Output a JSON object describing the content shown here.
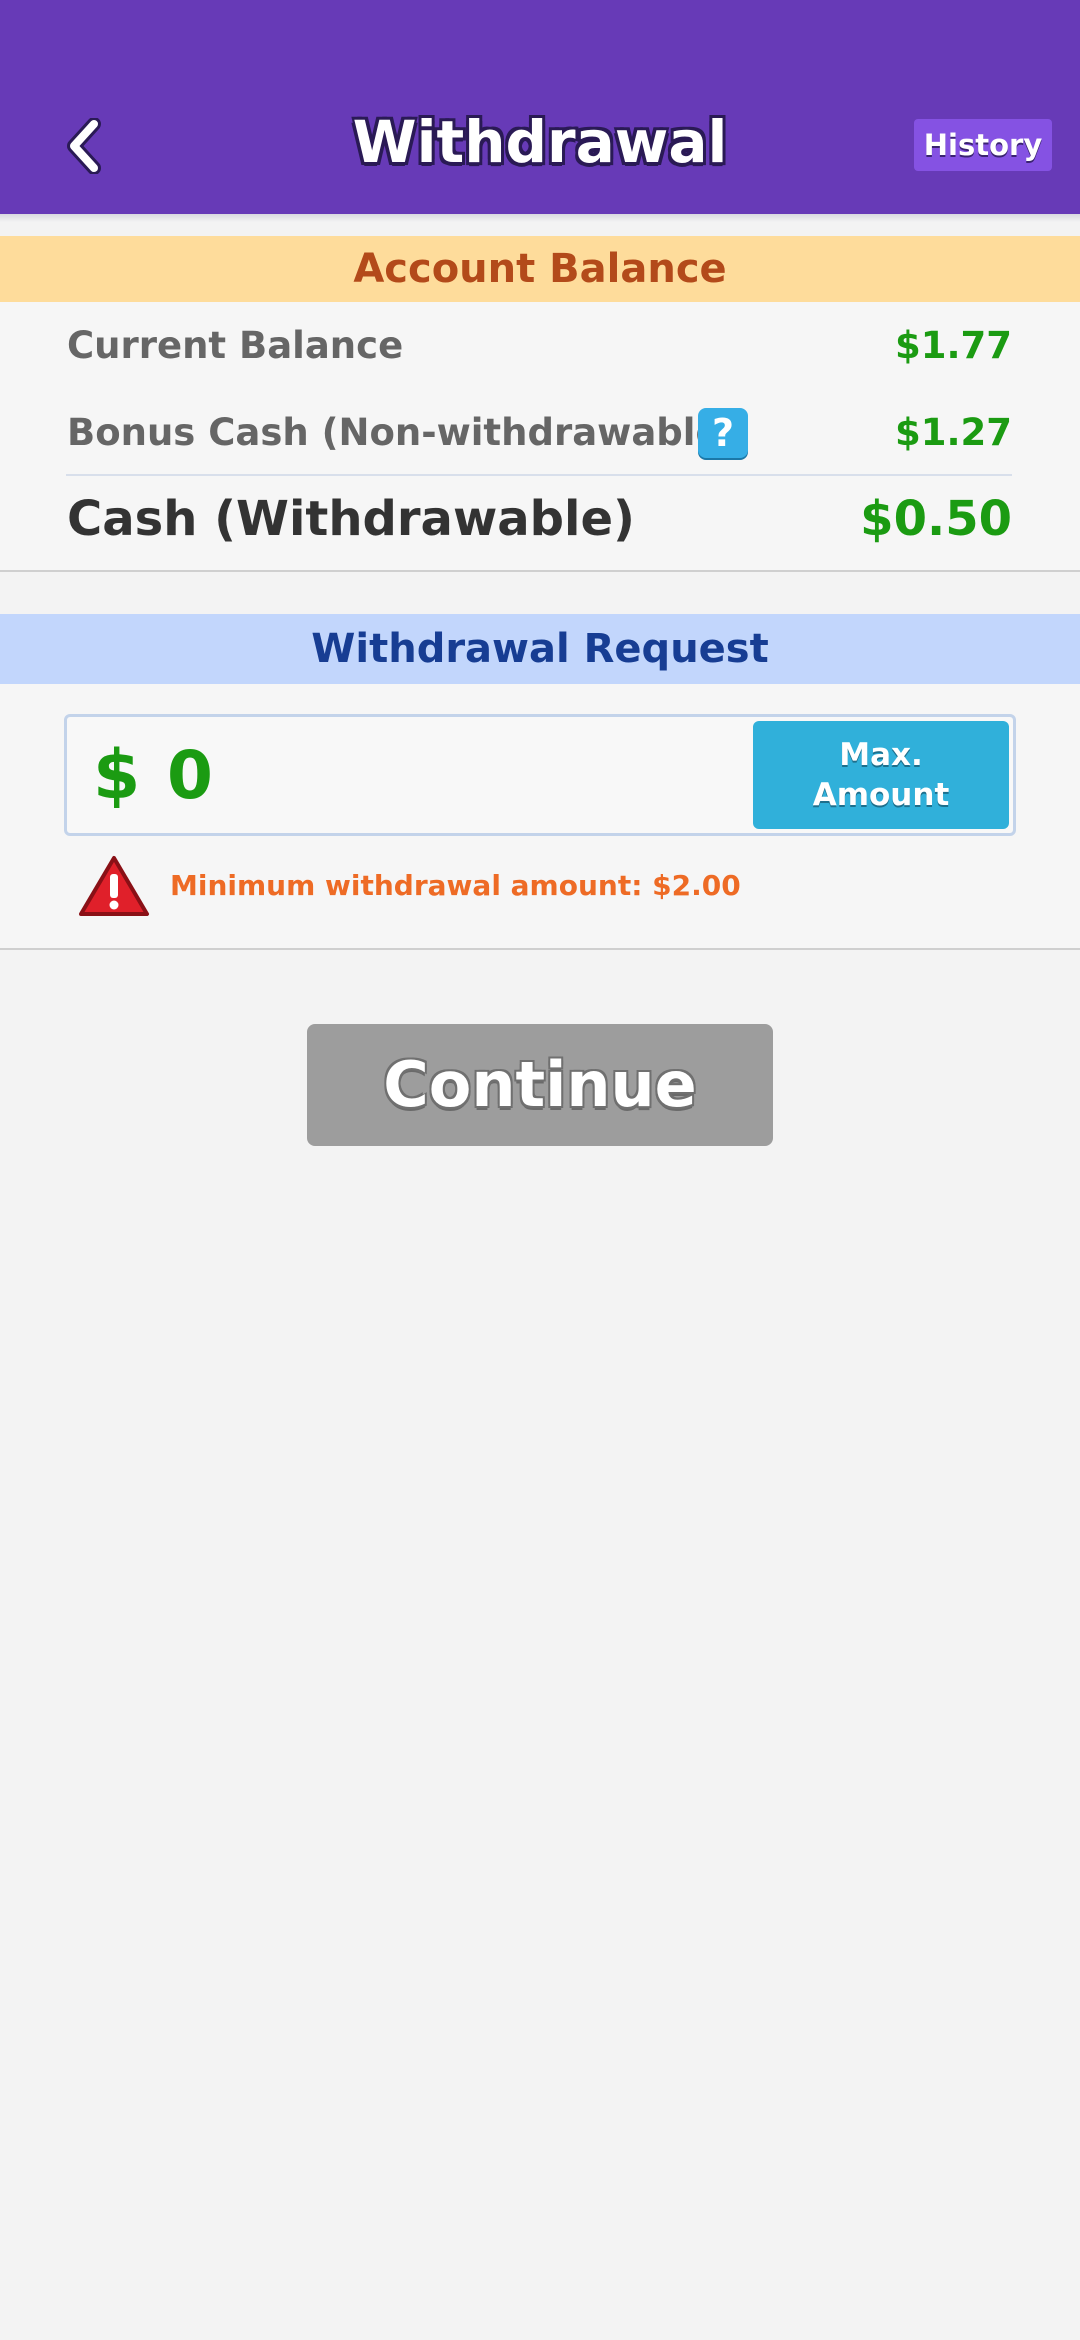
{
  "header": {
    "title": "Withdrawal",
    "back_icon": "chevron-left-icon",
    "history_label": "History",
    "color": "#673ab7"
  },
  "account_balance": {
    "heading": "Account Balance",
    "rows": [
      {
        "label": "Current Balance",
        "value": "$1.77"
      },
      {
        "label": "Bonus Cash (Non-withdrawable)",
        "value": "$1.27",
        "help_icon": "question-mark-icon",
        "help_text": "?"
      }
    ],
    "total": {
      "label": "Cash (Withdrawable)",
      "value": "$0.50"
    }
  },
  "withdrawal_request": {
    "heading": "Withdrawal Request",
    "currency_symbol": "$",
    "amount_value": "0",
    "max_button": {
      "line1": "Max.",
      "line2": "Amount"
    },
    "warning_icon": "warning-triangle-icon",
    "warning_text": "Minimum withdrawal amount: $2.00"
  },
  "continue_label": "Continue",
  "colors": {
    "accent": "#673ab7",
    "money_green": "#1b9b12",
    "warning_orange": "#ee6b25",
    "disabled_gray": "#9d9d9d"
  }
}
